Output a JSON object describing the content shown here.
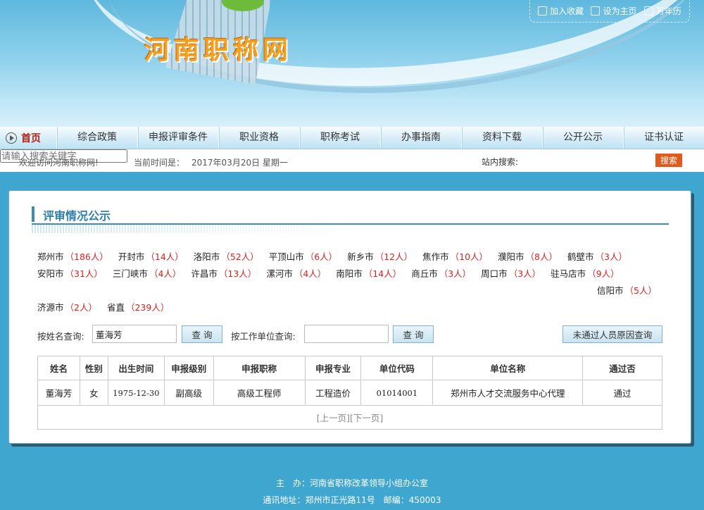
{
  "header": {
    "site_title": "河南职称网",
    "links": [
      {
        "label": "加入收藏",
        "icon": "bookmark-icon"
      },
      {
        "label": "设为主页",
        "icon": "home-icon"
      },
      {
        "label": "万年历",
        "icon": "calendar-icon"
      }
    ]
  },
  "nav": {
    "home": "首页",
    "items": [
      "综合政策",
      "申报评审条件",
      "职业资格",
      "职称考试",
      "办事指南",
      "资料下载",
      "公开公示",
      "证书认证"
    ]
  },
  "infobar": {
    "welcome": "欢迎访问河南职称网!",
    "time_label": "当前时间是：",
    "date": "2017年03月20日 星期一",
    "search_label": "站内搜索:",
    "search_placeholder": "请输入搜索关键字",
    "search_button": "搜索"
  },
  "panel": {
    "title": "评审情况公示",
    "cities_row1": [
      {
        "name": "郑州市",
        "count": "（186人）"
      },
      {
        "name": "开封市",
        "count": "（14人）"
      },
      {
        "name": "洛阳市",
        "count": "（52人）"
      },
      {
        "name": "平顶山市",
        "count": "（6人）"
      },
      {
        "name": "新乡市",
        "count": "（12人）"
      },
      {
        "name": "焦作市",
        "count": "（10人）"
      },
      {
        "name": "濮阳市",
        "count": "（8人）"
      },
      {
        "name": "鹤壁市",
        "count": "（3人）"
      }
    ],
    "cities_row2": [
      {
        "name": "安阳市",
        "count": "（31人）"
      },
      {
        "name": "三门峡市",
        "count": "（4人）"
      },
      {
        "name": "许昌市",
        "count": "（13人）"
      },
      {
        "name": "漯河市",
        "count": "（4人）"
      },
      {
        "name": "南阳市",
        "count": "（14人）"
      },
      {
        "name": "商丘市",
        "count": "（3人）"
      },
      {
        "name": "周口市",
        "count": "（3人）"
      },
      {
        "name": "驻马店市",
        "count": "（9人）"
      }
    ],
    "cities_row3": [
      {
        "name": "信阳市",
        "count": "（5人）"
      }
    ],
    "cities_row4": [
      {
        "name": "济源市",
        "count": "（2人）"
      },
      {
        "name": "省直",
        "count": "（239人）"
      }
    ],
    "query": {
      "name_label": "按姓名查询:",
      "name_value": "董海芳",
      "query_button": "查 询",
      "unit_label": "按工作单位查询:",
      "unit_value": "",
      "reason_button": "未通过人员原因查询"
    },
    "table": {
      "headers": [
        "姓名",
        "性别",
        "出生时间",
        "申报级别",
        "申报职称",
        "申报专业",
        "单位代码",
        "单位名称",
        "通过否"
      ],
      "rows": [
        [
          "董海芳",
          "女",
          "1975-12-30",
          "副高级",
          "高级工程师",
          "工程造价",
          "01014001",
          "郑州市人才交流服务中心代理",
          "通过"
        ]
      ],
      "prev": "[上一页]",
      "next": "[下一页]"
    }
  },
  "footer": {
    "line1": "主　办：河南省职称改革领导小组办公室",
    "line2": "通讯地址：郑州市正光路11号　邮编：450003"
  }
}
